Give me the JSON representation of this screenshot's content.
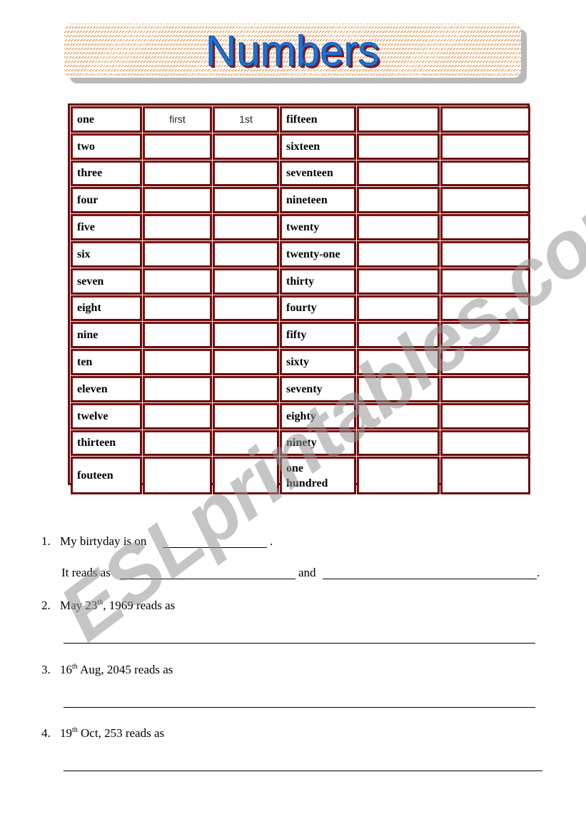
{
  "header": {
    "title": "Numbers"
  },
  "table": {
    "rows": [
      {
        "left": "one",
        "ordinal_word": "first",
        "ordinal_abbr": "1st",
        "right": "fifteen"
      },
      {
        "left": "two",
        "ordinal_word": "",
        "ordinal_abbr": "",
        "right": "sixteen"
      },
      {
        "left": "three",
        "ordinal_word": "",
        "ordinal_abbr": "",
        "right": "seventeen"
      },
      {
        "left": "four",
        "ordinal_word": "",
        "ordinal_abbr": "",
        "right": "nineteen"
      },
      {
        "left": "five",
        "ordinal_word": "",
        "ordinal_abbr": "",
        "right": "twenty"
      },
      {
        "left": "six",
        "ordinal_word": "",
        "ordinal_abbr": "",
        "right": "twenty-one"
      },
      {
        "left": "seven",
        "ordinal_word": "",
        "ordinal_abbr": "",
        "right": "thirty"
      },
      {
        "left": "eight",
        "ordinal_word": "",
        "ordinal_abbr": "",
        "right": "fourty"
      },
      {
        "left": "nine",
        "ordinal_word": "",
        "ordinal_abbr": "",
        "right": "fifty"
      },
      {
        "left": "ten",
        "ordinal_word": "",
        "ordinal_abbr": "",
        "right": "sixty"
      },
      {
        "left": "eleven",
        "ordinal_word": "",
        "ordinal_abbr": "",
        "right": "seventy"
      },
      {
        "left": "twelve",
        "ordinal_word": "",
        "ordinal_abbr": "",
        "right": "eighty"
      },
      {
        "left": "thirteen",
        "ordinal_word": "",
        "ordinal_abbr": "",
        "right": "ninety"
      },
      {
        "left": "fouteen",
        "ordinal_word": "",
        "ordinal_abbr": "",
        "right": "one hundred"
      }
    ]
  },
  "exercises": {
    "q1": {
      "number": "1.",
      "text": "My birtyday is on",
      "end": ".",
      "line2_prefix": "It reads as",
      "line2_mid": "and",
      "line2_end": "."
    },
    "q2": {
      "number": "2.",
      "pre": "May 23",
      "sup": "th",
      "post": ", 1969 reads as"
    },
    "q3": {
      "number": "3.",
      "pre": "16",
      "sup": "th",
      "post": " Aug, 2045 reads as"
    },
    "q4": {
      "number": "4.",
      "pre": "19",
      "sup": "th",
      "post": " Oct, 253 reads as"
    }
  },
  "watermark": {
    "text": "ESLprintables.com"
  }
}
